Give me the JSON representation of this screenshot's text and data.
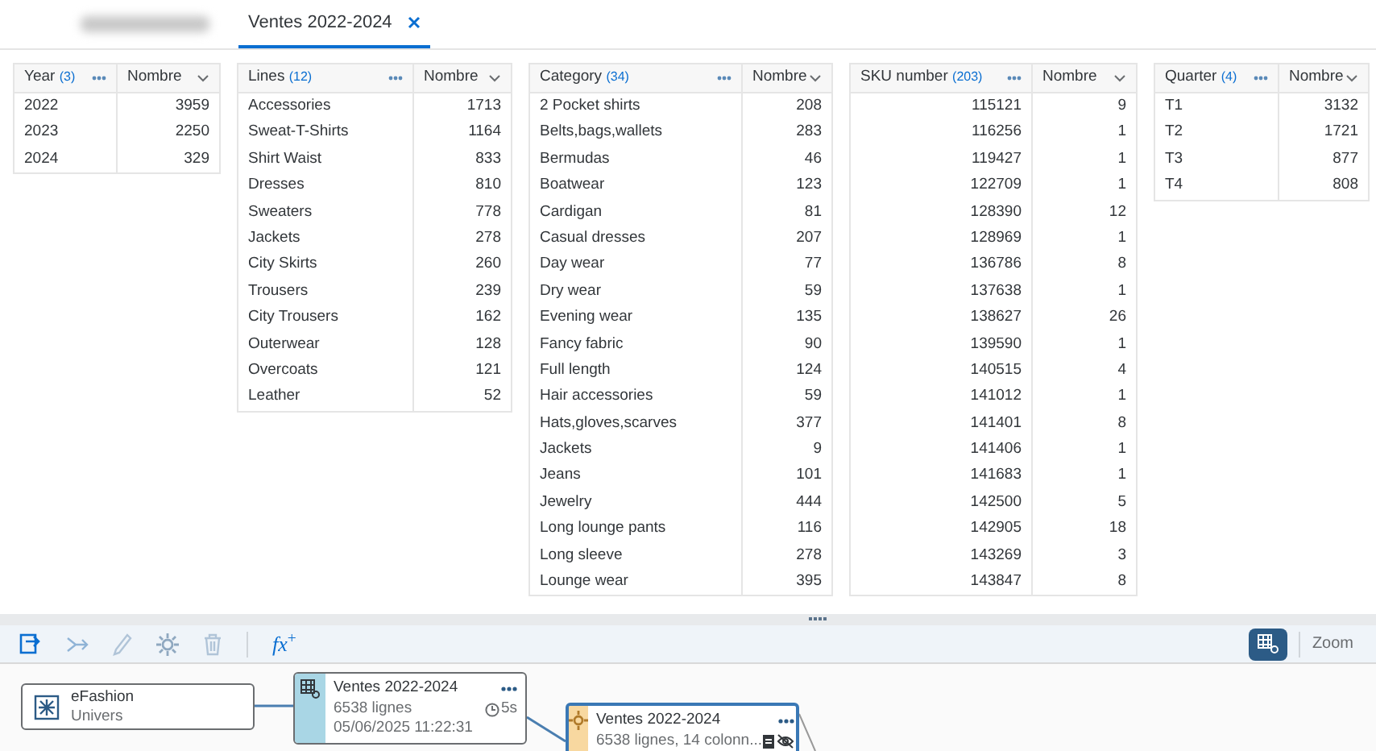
{
  "tabs": [
    {
      "label": "Ventes 2022-2024",
      "selected": true
    }
  ],
  "tables": [
    {
      "dimension": "Year",
      "count": "(3)",
      "measure": "Nombre",
      "rows": [
        [
          "2022",
          "3959"
        ],
        [
          "2023",
          "2250"
        ],
        [
          "2024",
          "329"
        ]
      ]
    },
    {
      "dimension": "Lines",
      "count": "(12)",
      "measure": "Nombre",
      "rows": [
        [
          "Accessories",
          "1713"
        ],
        [
          "Sweat-T-Shirts",
          "1164"
        ],
        [
          "Shirt Waist",
          "833"
        ],
        [
          "Dresses",
          "810"
        ],
        [
          "Sweaters",
          "778"
        ],
        [
          "Jackets",
          "278"
        ],
        [
          "City Skirts",
          "260"
        ],
        [
          "Trousers",
          "239"
        ],
        [
          "City Trousers",
          "162"
        ],
        [
          "Outerwear",
          "128"
        ],
        [
          "Overcoats",
          "121"
        ],
        [
          "Leather",
          "52"
        ]
      ]
    },
    {
      "dimension": "Category",
      "count": "(34)",
      "measure": "Nombre",
      "rows": [
        [
          "2 Pocket shirts",
          "208"
        ],
        [
          "Belts,bags,wallets",
          "283"
        ],
        [
          "Bermudas",
          "46"
        ],
        [
          "Boatwear",
          "123"
        ],
        [
          "Cardigan",
          "81"
        ],
        [
          "Casual dresses",
          "207"
        ],
        [
          "Day wear",
          "77"
        ],
        [
          "Dry wear",
          "59"
        ],
        [
          "Evening wear",
          "135"
        ],
        [
          "Fancy fabric",
          "90"
        ],
        [
          "Full length",
          "124"
        ],
        [
          "Hair accessories",
          "59"
        ],
        [
          "Hats,gloves,scarves",
          "377"
        ],
        [
          "Jackets",
          "9"
        ],
        [
          "Jeans",
          "101"
        ],
        [
          "Jewelry",
          "444"
        ],
        [
          "Long lounge pants",
          "116"
        ],
        [
          "Long sleeve",
          "278"
        ],
        [
          "Lounge wear",
          "395"
        ]
      ]
    },
    {
      "dimension": "SKU number",
      "count": "(203)",
      "measure": "Nombre",
      "numeric_key": true,
      "rows": [
        [
          "115121",
          "9"
        ],
        [
          "116256",
          "1"
        ],
        [
          "119427",
          "1"
        ],
        [
          "122709",
          "1"
        ],
        [
          "128390",
          "12"
        ],
        [
          "128969",
          "1"
        ],
        [
          "136786",
          "8"
        ],
        [
          "137638",
          "1"
        ],
        [
          "138627",
          "26"
        ],
        [
          "139590",
          "1"
        ],
        [
          "140515",
          "4"
        ],
        [
          "141012",
          "1"
        ],
        [
          "141401",
          "8"
        ],
        [
          "141406",
          "1"
        ],
        [
          "141683",
          "1"
        ],
        [
          "142500",
          "5"
        ],
        [
          "142905",
          "18"
        ],
        [
          "143269",
          "3"
        ],
        [
          "143847",
          "8"
        ]
      ]
    },
    {
      "dimension": "Quarter",
      "count": "(4)",
      "measure": "Nombre",
      "rows": [
        [
          "T1",
          "3132"
        ],
        [
          "T2",
          "1721"
        ],
        [
          "T3",
          "877"
        ],
        [
          "T4",
          "808"
        ]
      ]
    }
  ],
  "toolbar": {
    "formula_button": "*fx*$^{+}$",
    "zoom": "Zoom"
  },
  "nodes": [
    {
      "kind": "source",
      "title": "eFashion",
      "subtitle": "Univers",
      "selected": false
    },
    {
      "kind": "dataset",
      "title": "Ventes 2022-2024",
      "lines": [
        "6538 lignes",
        "05/06/2025 11:22:31"
      ],
      "duration": "5s",
      "selected": false
    },
    {
      "kind": "view",
      "title": "Ventes 2022-2024",
      "lines": [
        "6538 lignes, 14 colonn..."
      ],
      "selected": true
    }
  ]
}
